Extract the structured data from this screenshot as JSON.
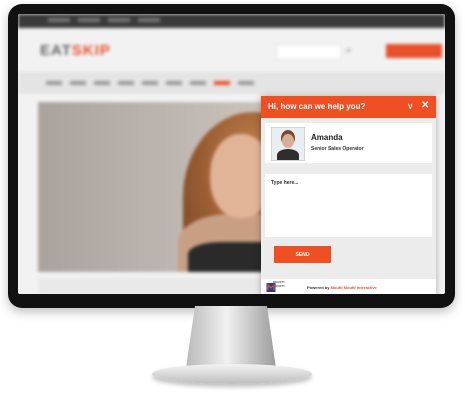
{
  "chat": {
    "title": "Hi, how can we help you?",
    "minimize_icon": "chevron-down-icon",
    "close_icon": "close-icon",
    "operator": {
      "name": "Amanda",
      "role": "Senior Sales Operator"
    },
    "message_placeholder": "Type here...",
    "send_label": "SEND",
    "footer": {
      "powered_by_prefix": "Powered by ",
      "powered_by_brand": "Moufti Moufti Interactive"
    },
    "accent_color": "#f04e23"
  },
  "website": {
    "accent_color": "#e8502a"
  }
}
